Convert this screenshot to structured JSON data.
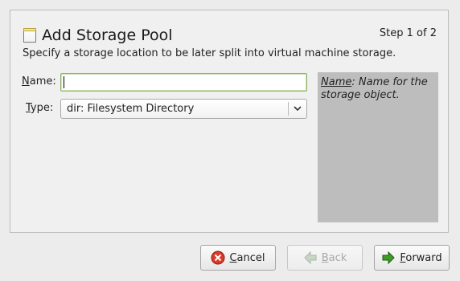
{
  "header": {
    "title": "Add Storage Pool",
    "step": "Step 1 of 2",
    "subtitle": "Specify a storage location to be later split into virtual machine storage."
  },
  "form": {
    "name_label_mnemonic": "N",
    "name_label_rest": "ame:",
    "name_value": "",
    "type_label_mnemonic": "T",
    "type_label_rest": "ype:",
    "type_value": "dir: Filesystem Directory"
  },
  "help": {
    "term": "Name",
    "description": ": Name for the storage object."
  },
  "buttons": {
    "cancel_mnemonic": "C",
    "cancel_rest": "ancel",
    "back_mnemonic": "B",
    "back_rest": "ack",
    "forward_mnemonic": "F",
    "forward_rest": "orward"
  },
  "colors": {
    "cancel_icon": "#d93b2b",
    "forward_icon": "#3f9a28",
    "back_icon_disabled": "#b5c7b0"
  },
  "icons": {
    "title": "storage-pool-icon",
    "cancel": "cancel-icon",
    "back": "back-arrow-icon",
    "forward": "forward-arrow-icon",
    "combo": "chevron-down-icon"
  }
}
